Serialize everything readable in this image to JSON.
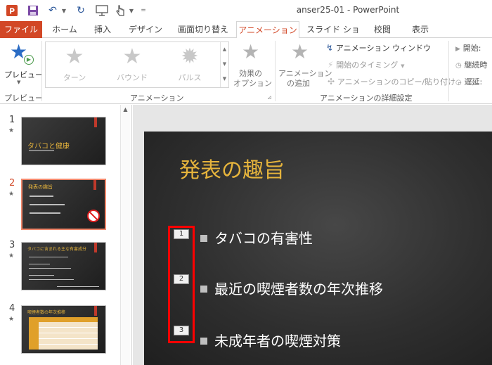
{
  "window": {
    "title": "anser25-01 - PowerPoint"
  },
  "quick_access": {
    "icons": [
      "save-icon",
      "undo-icon",
      "dropdown-icon",
      "repeat-icon",
      "slideshow-icon",
      "touch-mode-icon",
      "customize-icon"
    ]
  },
  "tabs": [
    {
      "label": "ファイル"
    },
    {
      "label": "ホーム"
    },
    {
      "label": "挿入"
    },
    {
      "label": "デザイン"
    },
    {
      "label": "画面切り替え"
    },
    {
      "label": "アニメーション"
    },
    {
      "label": "スライド ショー"
    },
    {
      "label": "校閲"
    },
    {
      "label": "表示"
    }
  ],
  "active_tab": "アニメーション",
  "ribbon": {
    "preview": {
      "button": "プレビュー",
      "group": "プレビュー"
    },
    "animation_group": {
      "label": "アニメーション",
      "gallery": [
        {
          "label": "ターン"
        },
        {
          "label": "バウンド"
        },
        {
          "label": "パルス"
        }
      ],
      "effect_options_line1": "効果の",
      "effect_options_line2": "オプション"
    },
    "advanced_group": {
      "label": "アニメーションの詳細設定",
      "add_animation_line1": "アニメーション",
      "add_animation_line2": "の追加",
      "animation_window": "アニメーション ウィンドウ",
      "trigger": "開始のタイミング",
      "animation_painter": "アニメーションのコピー/貼り付け"
    },
    "timing": {
      "start": "開始:",
      "duration": "継続時",
      "delay": "遅延:"
    }
  },
  "thumbnails": [
    {
      "number": "1",
      "star": "★",
      "title": "タバコと健康"
    },
    {
      "number": "2",
      "star": "★",
      "title": "発表の趣旨"
    },
    {
      "number": "3",
      "star": "★",
      "title": "タバコに含まれる主な有害成分"
    },
    {
      "number": "4",
      "star": "★",
      "title": "喫煙者数の年次推移"
    }
  ],
  "slide": {
    "title": "発表の趣旨",
    "bullets": [
      {
        "anim_number": "1",
        "text": "タバコの有害性"
      },
      {
        "anim_number": "2",
        "text": "最近の喫煙者数の年次推移"
      },
      {
        "anim_number": "3",
        "text": "未成年者の喫煙対策"
      }
    ]
  },
  "colors": {
    "accent": "#d24726",
    "slide_title": "#e6b43c",
    "highlight": "#ff0000"
  }
}
